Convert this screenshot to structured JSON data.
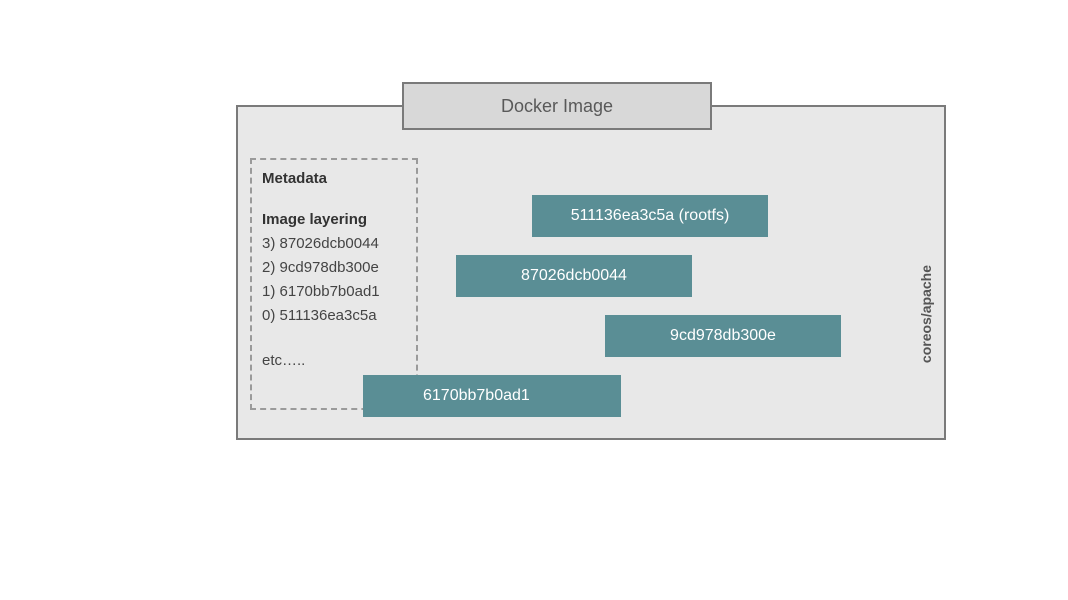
{
  "title": "Docker Image",
  "metadata": {
    "heading": "Metadata",
    "layering_heading": "Image layering",
    "layers": [
      {
        "index": "3)",
        "hash": "87026dcb0044"
      },
      {
        "index": "2)",
        "hash": "9cd978db300e"
      },
      {
        "index": "1)",
        "hash": "6170bb7b0ad1"
      },
      {
        "index": "0)",
        "hash": "511136ea3c5a"
      }
    ],
    "etc": "etc….."
  },
  "blocks": {
    "rootfs": "511136ea3c5a (rootfs)",
    "b1": "87026dcb0044",
    "b2": "9cd978db300e",
    "b3": "6170bb7b0ad1"
  },
  "side_label": "coreos/apache"
}
